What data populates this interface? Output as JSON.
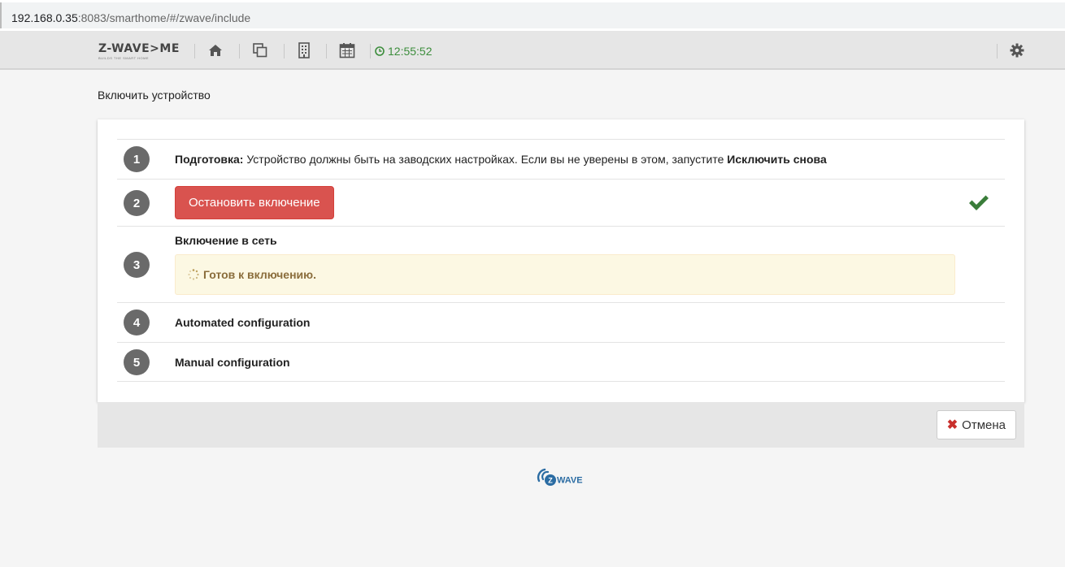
{
  "browser": {
    "url_host": "192.168.0.35",
    "url_rest": ":8083/smarthome/#/zwave/include"
  },
  "navbar": {
    "logo_text": "Z-WAVE>ME",
    "logo_subtitle": "BUILDS THE SMART HOME",
    "icons": [
      "home-icon",
      "copy-icon",
      "building-icon",
      "calendar-icon",
      "settings-icon"
    ],
    "clock": "12:55:52",
    "clock_color": "#3c8d3c"
  },
  "page": {
    "title": "Включить устройство"
  },
  "steps": [
    {
      "number": "1",
      "label": "Подготовка:",
      "text": " Устройство должны быть на заводских настройках. Если вы не уверены в этом, запустите ",
      "link": "Исключить снова"
    },
    {
      "number": "2",
      "button": "Остановить включение",
      "button_color": "#d9534f",
      "status_icon": "check-icon",
      "status_color": "#3a7d3a"
    },
    {
      "number": "3",
      "heading": "Включение в сеть",
      "alert": "Готов к включению.",
      "alert_icon": "spinner-icon"
    },
    {
      "number": "4",
      "heading": "Automated configuration"
    },
    {
      "number": "5",
      "heading": "Manual configuration"
    }
  ],
  "footer": {
    "cancel_label": "Отмена",
    "cancel_icon": "times-icon",
    "brand_logo": "ZWAVE"
  }
}
